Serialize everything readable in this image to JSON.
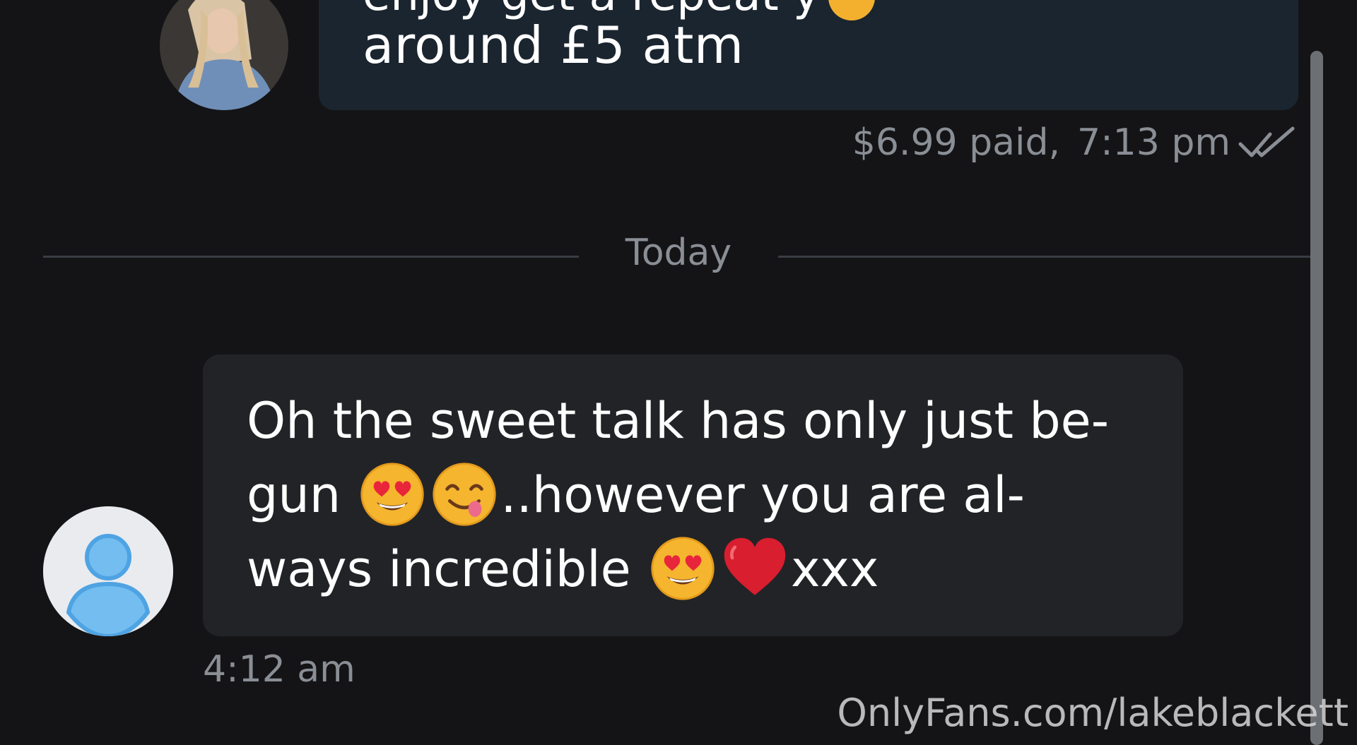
{
  "sent_message": {
    "clipped_line": "enjoy get a repeat y",
    "visible_line": "around £5 atm",
    "price_label": "$6.99 paid,",
    "time": "7:13 pm",
    "status_icon": "double-check-icon"
  },
  "divider": {
    "label": "Today"
  },
  "received_message": {
    "line1": "Oh the sweet talk has only just be-",
    "line2_start": "gun ",
    "line2_end": "..however you are al-",
    "line3_start": "ways incredible ",
    "line3_end": "xxx",
    "time": "4:12 am",
    "emojis": [
      "heart-eyes-emoji",
      "yum-emoji",
      "heart-eyes-emoji",
      "red-heart-emoji"
    ]
  },
  "watermark": {
    "text": "OnlyFans.com/lakeblackett"
  },
  "colors": {
    "background": "#141416",
    "sent_bubble": "#1a252f",
    "received_bubble": "#222327",
    "meta_text": "#8a8e95",
    "avatar_placeholder": "#5aaee8"
  }
}
